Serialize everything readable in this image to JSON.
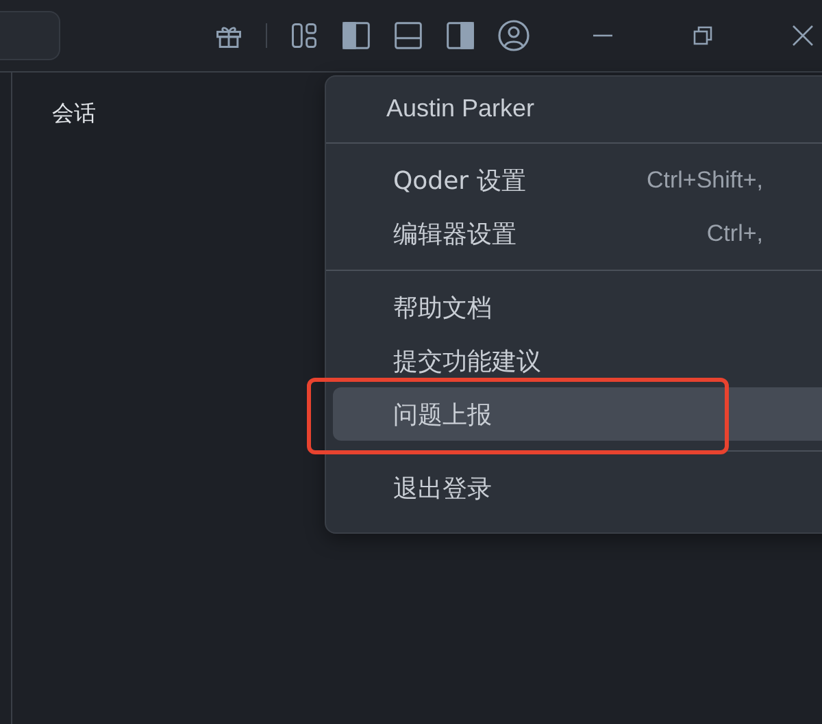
{
  "toolbar": {
    "panels": [
      {
        "kind": "left",
        "on": true
      },
      {
        "kind": "bottom",
        "on": false
      },
      {
        "kind": "right",
        "on": true
      }
    ]
  },
  "sidebar": {
    "title": "会话"
  },
  "account_menu": {
    "user": "Austin Parker",
    "groups": [
      [
        {
          "label": "Qoder 设置",
          "shortcut": "Ctrl+Shift+,",
          "selected": false
        },
        {
          "label": "编辑器设置",
          "shortcut": "Ctrl+,",
          "selected": false
        }
      ],
      [
        {
          "label": "帮助文档",
          "selected": false
        },
        {
          "label": "提交功能建议",
          "selected": false
        },
        {
          "label": "问题上报",
          "selected": true,
          "annotated": true
        }
      ],
      [
        {
          "label": "退出登录",
          "selected": false
        }
      ]
    ]
  }
}
